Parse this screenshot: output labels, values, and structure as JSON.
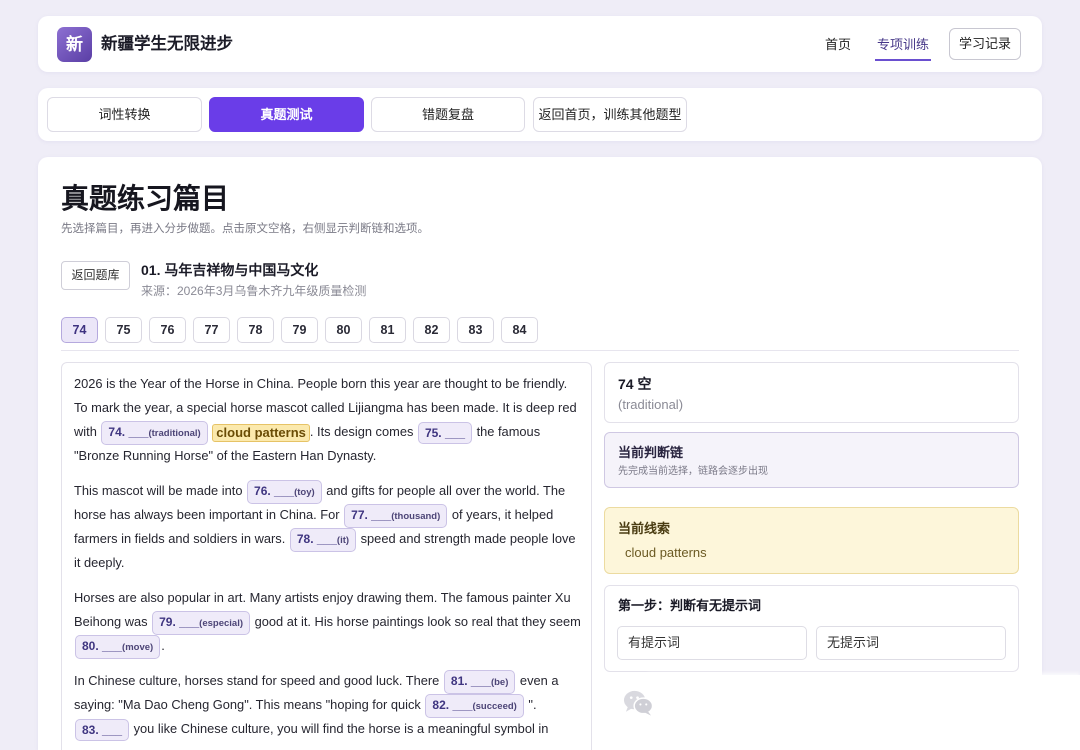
{
  "app": {
    "logo": "新",
    "title": "新疆学生无限进步"
  },
  "nav": {
    "home": "首页",
    "training": "专项训练",
    "records": "学习记录"
  },
  "tabs": [
    {
      "label": "词性转换"
    },
    {
      "label": "真题测试",
      "active": true
    },
    {
      "label": "错题复盘"
    },
    {
      "label": "返回首页，训练其他题型"
    }
  ],
  "page": {
    "title": "真题练习篇目",
    "subtitle": "先选择篇目，再进入分步做题。点击原文空格，右侧显示判断链和选项。"
  },
  "article": {
    "back": "返回题库",
    "title": "01. 马年吉祥物与中国马文化",
    "source": "来源：2026年3月乌鲁木齐九年级质量检测"
  },
  "questions": [
    {
      "n": "74",
      "active": true
    },
    {
      "n": "75"
    },
    {
      "n": "76"
    },
    {
      "n": "77"
    },
    {
      "n": "78"
    },
    {
      "n": "79"
    },
    {
      "n": "80"
    },
    {
      "n": "81"
    },
    {
      "n": "82"
    },
    {
      "n": "83"
    },
    {
      "n": "84"
    }
  ],
  "passage": [
    {
      "segments": [
        {
          "text": "2026 is the Year of the Horse in China. People born this year are thought to be friendly. To mark the year, a special horse mascot called Lijiangma has been made. It is deep red with "
        },
        {
          "blank": "74. ___",
          "hint": "(traditional)"
        },
        {
          "text": " "
        },
        {
          "clue": "cloud patterns"
        },
        {
          "text": ". Its design comes "
        },
        {
          "blank": "75. ___"
        },
        {
          "text": " the famous \"Bronze Running Horse\" of the Eastern Han Dynasty."
        }
      ]
    },
    {
      "segments": [
        {
          "text": "This mascot will be made into "
        },
        {
          "blank": "76. ___",
          "hint": "(toy)"
        },
        {
          "text": " and gifts for people all over the world. The horse has always been important in China. For "
        },
        {
          "blank": "77. ___",
          "hint": "(thousand)"
        },
        {
          "text": " of years, it helped farmers in fields and soldiers in wars. "
        },
        {
          "blank": "78. ___",
          "hint": "(it)"
        },
        {
          "text": " speed and strength made people love it deeply."
        }
      ]
    },
    {
      "segments": [
        {
          "text": "Horses are also popular in art. Many artists enjoy drawing them. The famous painter Xu Beihong was "
        },
        {
          "blank": "79. ___",
          "hint": "(especial)"
        },
        {
          "text": " good at it. His horse paintings look so real that they seem "
        },
        {
          "blank": "80. ___",
          "hint": "(move)"
        },
        {
          "text": "."
        }
      ]
    },
    {
      "segments": [
        {
          "text": "In Chinese culture, horses stand for speed and good luck. There "
        },
        {
          "blank": "81. ___",
          "hint": "(be)"
        },
        {
          "text": " even a saying: \"Ma Dao Cheng Gong\". This means \"hoping for quick "
        },
        {
          "blank": "82. ___",
          "hint": "(succeed)"
        },
        {
          "text": " \". "
        },
        {
          "blank": "83. ___"
        },
        {
          "text": " you like Chinese culture, you will find the horse is a meaningful symbol in"
        }
      ]
    }
  ],
  "side": {
    "current": {
      "title": "74 空",
      "hint": "(traditional)"
    },
    "chain": {
      "title": "当前判断链",
      "desc": "先完成当前选择，链路会逐步出现"
    },
    "clue": {
      "title": "当前线索",
      "text": "cloud patterns"
    },
    "step": {
      "title": "第一步：判断有无提示词",
      "options": [
        "有提示词",
        "无提示词"
      ]
    }
  },
  "colors": {
    "accent": "#6a3de8",
    "page_background": "#efedf7",
    "clue_highlight": "#fbe9ad",
    "blank_chip": "#efebf9"
  }
}
